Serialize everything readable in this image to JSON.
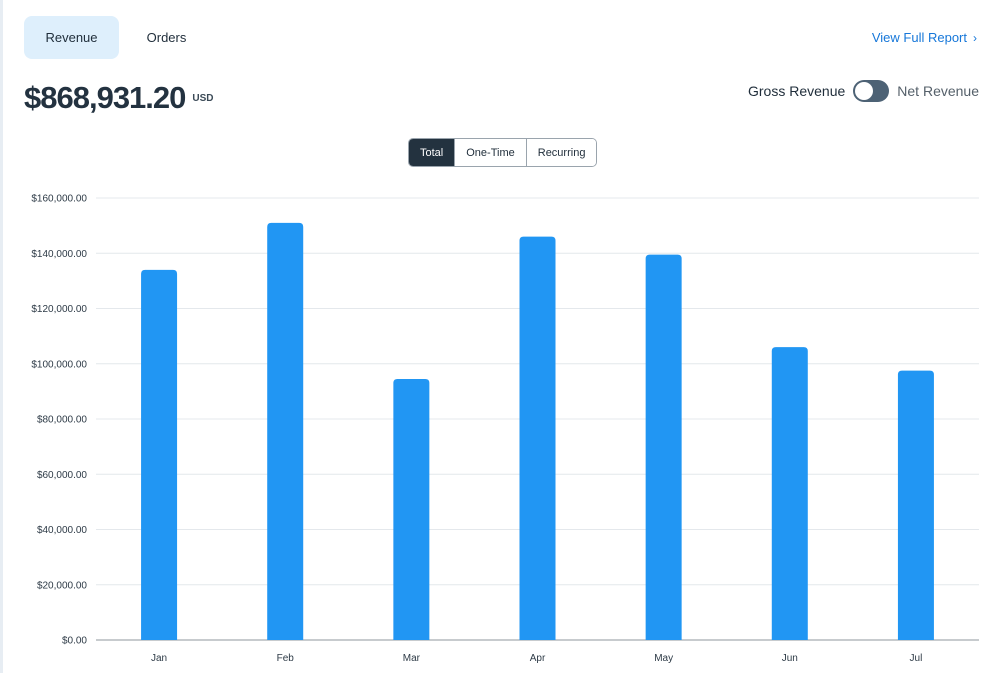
{
  "tabs": [
    {
      "label": "Revenue",
      "active": true
    },
    {
      "label": "Orders",
      "active": false
    }
  ],
  "report_link": {
    "label": "View Full Report",
    "chevron": "›"
  },
  "total": {
    "amount": "$868,931.20",
    "currency": "USD"
  },
  "toggle": {
    "left_label": "Gross Revenue",
    "right_label": "Net Revenue"
  },
  "segments": [
    {
      "label": "Total",
      "active": true
    },
    {
      "label": "One-Time",
      "active": false
    },
    {
      "label": "Recurring",
      "active": false
    }
  ],
  "colors": {
    "bar": "#2196f3",
    "accent": "#1677d9"
  },
  "chart_data": {
    "type": "bar",
    "categories": [
      "Jan",
      "Feb",
      "Mar",
      "Apr",
      "May",
      "Jun",
      "Jul"
    ],
    "values": [
      134000,
      151000,
      94500,
      146000,
      139500,
      106000,
      97500
    ],
    "yticks": [
      "$0.00",
      "$20,000.00",
      "$40,000.00",
      "$60,000.00",
      "$80,000.00",
      "$100,000.00",
      "$120,000.00",
      "$140,000.00",
      "$160,000.00"
    ],
    "ylim": [
      0,
      160000
    ],
    "grid": true
  }
}
